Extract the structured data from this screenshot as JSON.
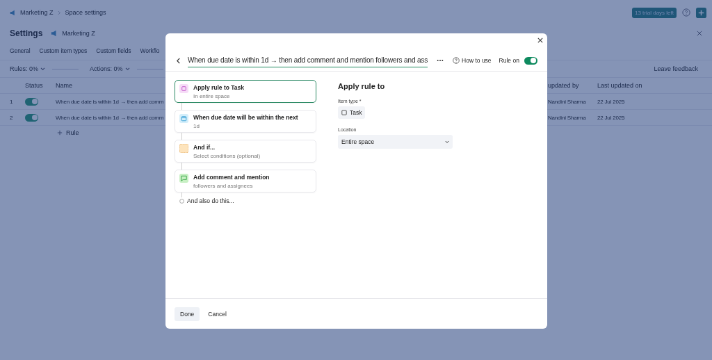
{
  "topbar": {
    "breadcrumb": [
      "Marketing Z",
      "Space settings"
    ],
    "trial_badge": "13 trial days left"
  },
  "header": {
    "title": "Settings",
    "space": "Marketing Z"
  },
  "tabs": [
    "General",
    "Custom item types",
    "Custom fields",
    "Workflo"
  ],
  "filters": [
    "Rules: 0%",
    "Actions: 0%"
  ],
  "feedback": "Leave feedback",
  "table": {
    "columns": [
      "Status",
      "Name",
      "updated by",
      "Last updated on"
    ],
    "rows": [
      {
        "index": "1",
        "on": true,
        "name": "When due date is within 1d → then add comm",
        "updated_by": "Nandini Sharma",
        "updated_on": "22 Jul 2025"
      },
      {
        "index": "2",
        "on": true,
        "name": "When due date is within 1d → then add comm",
        "updated_by": "Nandini Sharma",
        "updated_on": "22 Jul 2025"
      }
    ]
  },
  "add_rule": "Rule",
  "modal": {
    "title": "When due date is within 1d → then add comment and mention followers and ass",
    "how_to_use": "How to use",
    "rule_on_label": "Rule on",
    "rule_on": true,
    "steps": [
      {
        "kind": "scope",
        "title": "Apply rule to Task",
        "subtitle": "In entire space",
        "selected": true
      },
      {
        "kind": "trigger",
        "title": "When due date will be within the next",
        "subtitle": "1d",
        "selected": false
      },
      {
        "kind": "condition",
        "title": "And if...",
        "subtitle": "Select conditions (optional)",
        "selected": false
      },
      {
        "kind": "action",
        "title": "Add comment and mention",
        "subtitle": "followers and assignees",
        "selected": false
      }
    ],
    "add_more": "And also do this...",
    "panel": {
      "heading": "Apply rule to",
      "item_type_label": "Item type *",
      "item_type": "Task",
      "location_label": "Location",
      "location": "Entire space"
    },
    "buttons": [
      "Done",
      "Cancel"
    ]
  }
}
